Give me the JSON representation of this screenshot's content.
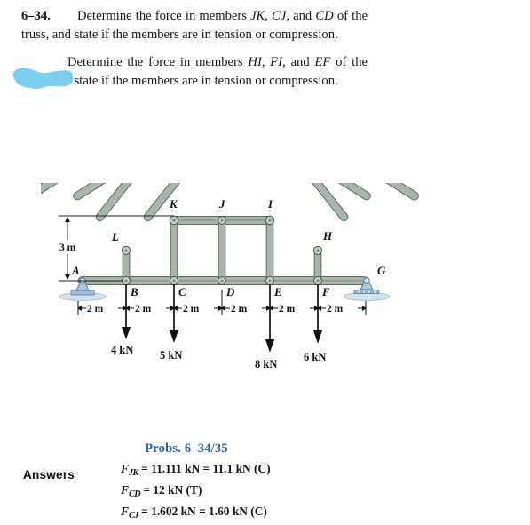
{
  "problem": {
    "number": "6–34.",
    "statement_1_lead": "Determine the force in members ",
    "statement_1_members": "JK, CJ,",
    "statement_1_mid": " and ",
    "statement_1_members2": "CD",
    "statement_1_tail": " of the truss, and state if the members are in tension or compression.",
    "statement_2_lead": "Determine the force in members ",
    "statement_2_members": "HI, FI,",
    "statement_2_mid": " and ",
    "statement_2_members2": "EF",
    "statement_2_tail": " of the truss, and state if the members are in tension or compression.",
    "highlight_color": "#7ecef0",
    "highlight_note": "blue-highlighter-scribble-over-second-problem-number"
  },
  "figure": {
    "caption": "Probs. 6–34/35",
    "caption_color": "#2c5fa8",
    "member_fill": "#a4b0a5",
    "member_stroke": "#5c6b5f",
    "support_color": "#a9c6dd",
    "height_dimension": "3 m",
    "joint_labels": {
      "A": "A",
      "B": "B",
      "C": "C",
      "D": "D",
      "E": "E",
      "F": "F",
      "G": "G",
      "H": "H",
      "I": "I",
      "J": "J",
      "K": "K",
      "L": "L"
    },
    "panel_dimensions": [
      "2 m",
      "2 m",
      "2 m",
      "2 m",
      "2 m",
      "2 m"
    ],
    "loads": [
      {
        "joint": "B",
        "label": "4 kN"
      },
      {
        "joint": "C",
        "label": "5 kN"
      },
      {
        "joint": "E",
        "label": "8 kN"
      },
      {
        "joint": "F",
        "label": "6 kN"
      }
    ],
    "supports": [
      {
        "joint": "A",
        "type": "pin"
      },
      {
        "joint": "G",
        "type": "roller"
      }
    ]
  },
  "answers": {
    "label": "Answers",
    "lines": [
      {
        "symbol": "F",
        "sub": "JK",
        "text": " = 11.111 kN = 11.1 kN (C)"
      },
      {
        "symbol": "F",
        "sub": "CD",
        "text": " = 12 kN (T)"
      },
      {
        "symbol": "F",
        "sub": "CJ",
        "text": " = 1.602 kN = 1.60 kN (C)"
      }
    ]
  }
}
